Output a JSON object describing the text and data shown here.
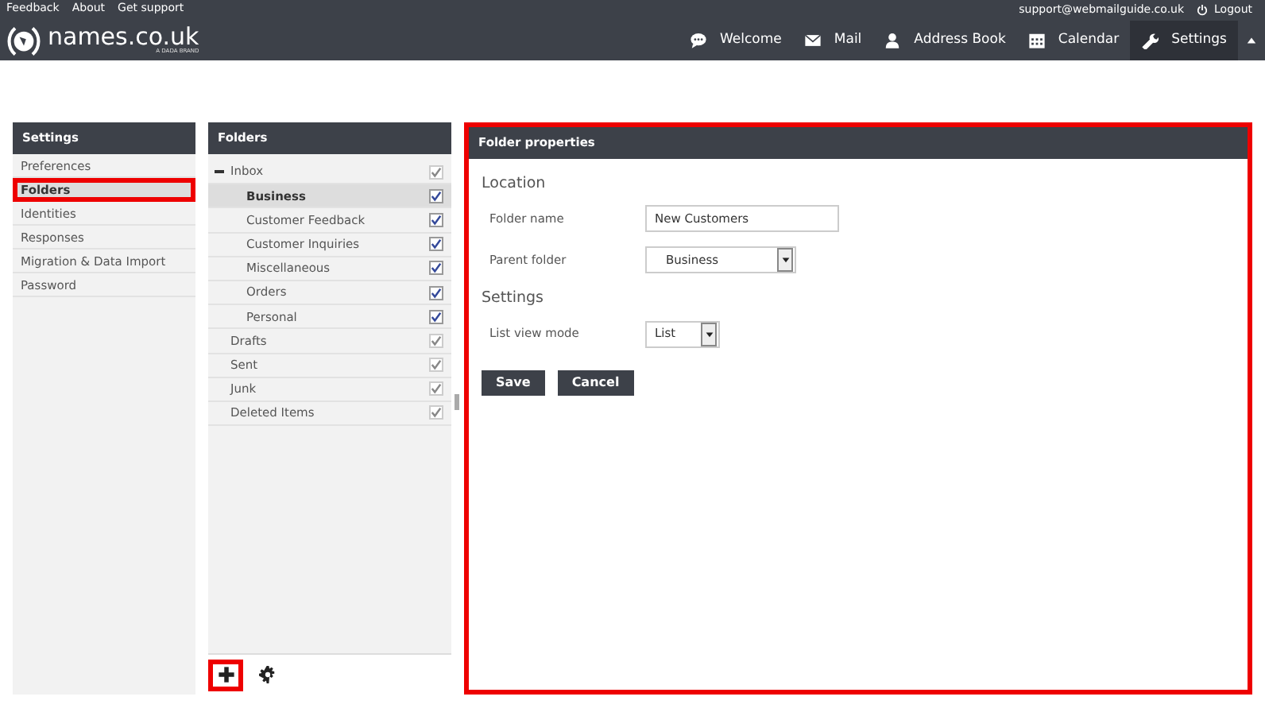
{
  "top_links": [
    "Feedback",
    "About",
    "Get support"
  ],
  "account": {
    "email": "support@webmailguide.co.uk",
    "logout": "Logout"
  },
  "logo": {
    "name": "names.co.uk",
    "tagline": "A DADA BRAND"
  },
  "nav": [
    {
      "label": "Welcome",
      "selected": false
    },
    {
      "label": "Mail",
      "selected": false
    },
    {
      "label": "Address Book",
      "selected": false
    },
    {
      "label": "Calendar",
      "selected": false
    },
    {
      "label": "Settings",
      "selected": true
    }
  ],
  "sidebar": {
    "title": "Settings",
    "items": [
      {
        "label": "Preferences",
        "selected": false,
        "highlighted": false
      },
      {
        "label": "Folders",
        "selected": true,
        "highlighted": true
      },
      {
        "label": "Identities",
        "selected": false,
        "highlighted": false
      },
      {
        "label": "Responses",
        "selected": false,
        "highlighted": false
      },
      {
        "label": "Migration & Data Import",
        "selected": false,
        "highlighted": false
      },
      {
        "label": "Password",
        "selected": false,
        "highlighted": false
      }
    ]
  },
  "folders": {
    "title": "Folders",
    "items": [
      {
        "label": "Inbox",
        "expanded": true,
        "selected": false,
        "checked": true,
        "disabled": true,
        "children": [
          {
            "label": "Business",
            "selected": true,
            "checked": true,
            "disabled": false
          },
          {
            "label": "Customer Feedback",
            "selected": false,
            "checked": true,
            "disabled": false
          },
          {
            "label": "Customer Inquiries",
            "selected": false,
            "checked": true,
            "disabled": false
          },
          {
            "label": "Miscellaneous",
            "selected": false,
            "checked": true,
            "disabled": false
          },
          {
            "label": "Orders",
            "selected": false,
            "checked": true,
            "disabled": false
          },
          {
            "label": "Personal",
            "selected": false,
            "checked": true,
            "disabled": false
          }
        ]
      },
      {
        "label": "Drafts",
        "selected": false,
        "checked": true,
        "disabled": true
      },
      {
        "label": "Sent",
        "selected": false,
        "checked": true,
        "disabled": true
      },
      {
        "label": "Junk",
        "selected": false,
        "checked": true,
        "disabled": true
      },
      {
        "label": "Deleted Items",
        "selected": false,
        "checked": true,
        "disabled": true
      }
    ],
    "footer": [
      {
        "kind": "add",
        "highlighted": true
      },
      {
        "kind": "settings",
        "highlighted": false
      }
    ]
  },
  "properties": {
    "title": "Folder properties",
    "highlighted": true,
    "sections": [
      {
        "title": "Location",
        "fields": [
          {
            "label": "Folder name",
            "kind": "text",
            "value": "New Customers"
          },
          {
            "label": "Parent folder",
            "kind": "select",
            "value": "Business"
          }
        ]
      },
      {
        "title": "Settings",
        "fields": [
          {
            "label": "List view mode",
            "kind": "select",
            "value": "List"
          }
        ]
      }
    ],
    "buttons": [
      "Save",
      "Cancel"
    ]
  }
}
